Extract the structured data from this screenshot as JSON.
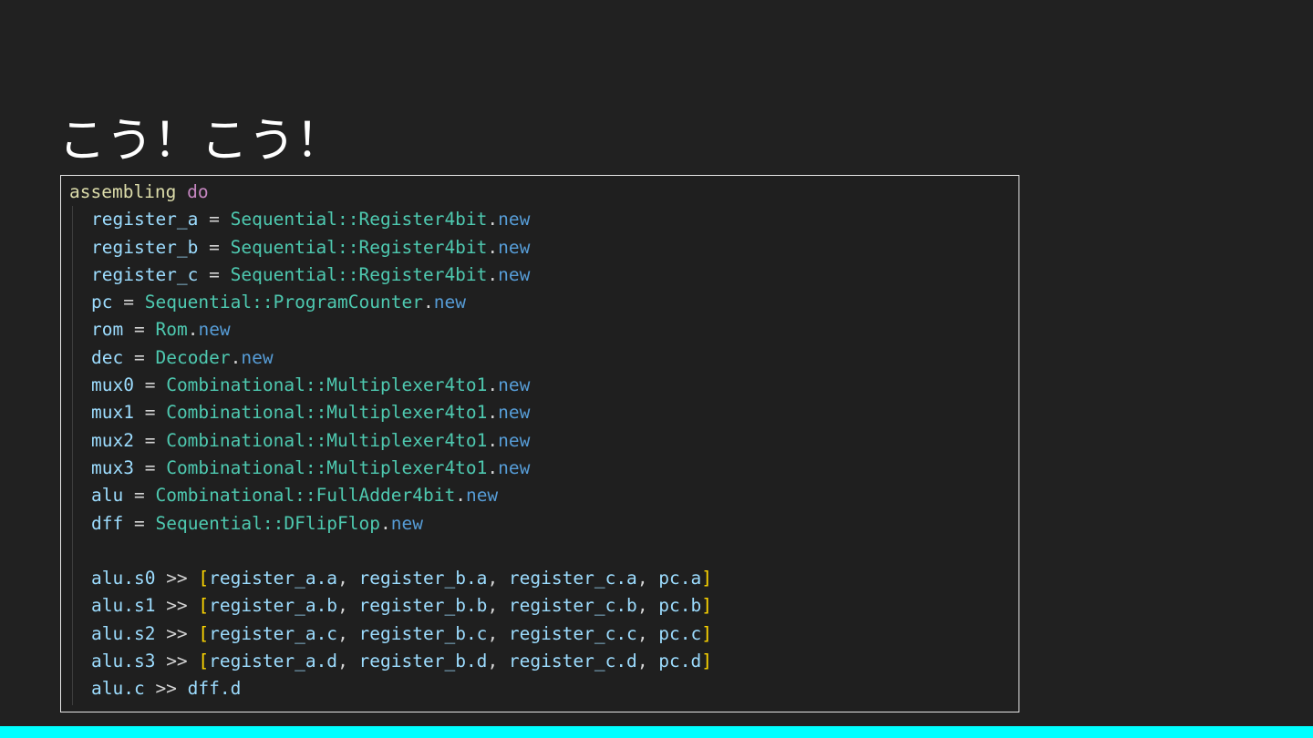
{
  "slide": {
    "title": "こう！こう！"
  },
  "code": {
    "lines": [
      [
        {
          "t": "assembling",
          "c": "fn"
        },
        {
          "t": " ",
          "c": "op"
        },
        {
          "t": "do",
          "c": "kw"
        }
      ],
      [
        {
          "t": "register_a",
          "c": "var"
        },
        {
          "t": " = ",
          "c": "op"
        },
        {
          "t": "Sequential::Register4bit",
          "c": "cls"
        },
        {
          "t": ".",
          "c": "op"
        },
        {
          "t": "new",
          "c": "new"
        }
      ],
      [
        {
          "t": "register_b",
          "c": "var"
        },
        {
          "t": " = ",
          "c": "op"
        },
        {
          "t": "Sequential::Register4bit",
          "c": "cls"
        },
        {
          "t": ".",
          "c": "op"
        },
        {
          "t": "new",
          "c": "new"
        }
      ],
      [
        {
          "t": "register_c",
          "c": "var"
        },
        {
          "t": " = ",
          "c": "op"
        },
        {
          "t": "Sequential::Register4bit",
          "c": "cls"
        },
        {
          "t": ".",
          "c": "op"
        },
        {
          "t": "new",
          "c": "new"
        }
      ],
      [
        {
          "t": "pc",
          "c": "var"
        },
        {
          "t": " = ",
          "c": "op"
        },
        {
          "t": "Sequential::ProgramCounter",
          "c": "cls"
        },
        {
          "t": ".",
          "c": "op"
        },
        {
          "t": "new",
          "c": "new"
        }
      ],
      [
        {
          "t": "rom",
          "c": "var"
        },
        {
          "t": " = ",
          "c": "op"
        },
        {
          "t": "Rom",
          "c": "cls"
        },
        {
          "t": ".",
          "c": "op"
        },
        {
          "t": "new",
          "c": "new"
        }
      ],
      [
        {
          "t": "dec",
          "c": "var"
        },
        {
          "t": " = ",
          "c": "op"
        },
        {
          "t": "Decoder",
          "c": "cls"
        },
        {
          "t": ".",
          "c": "op"
        },
        {
          "t": "new",
          "c": "new"
        }
      ],
      [
        {
          "t": "mux0",
          "c": "var"
        },
        {
          "t": " = ",
          "c": "op"
        },
        {
          "t": "Combinational::Multiplexer4to1",
          "c": "cls"
        },
        {
          "t": ".",
          "c": "op"
        },
        {
          "t": "new",
          "c": "new"
        }
      ],
      [
        {
          "t": "mux1",
          "c": "var"
        },
        {
          "t": " = ",
          "c": "op"
        },
        {
          "t": "Combinational::Multiplexer4to1",
          "c": "cls"
        },
        {
          "t": ".",
          "c": "op"
        },
        {
          "t": "new",
          "c": "new"
        }
      ],
      [
        {
          "t": "mux2",
          "c": "var"
        },
        {
          "t": " = ",
          "c": "op"
        },
        {
          "t": "Combinational::Multiplexer4to1",
          "c": "cls"
        },
        {
          "t": ".",
          "c": "op"
        },
        {
          "t": "new",
          "c": "new"
        }
      ],
      [
        {
          "t": "mux3",
          "c": "var"
        },
        {
          "t": " = ",
          "c": "op"
        },
        {
          "t": "Combinational::Multiplexer4to1",
          "c": "cls"
        },
        {
          "t": ".",
          "c": "op"
        },
        {
          "t": "new",
          "c": "new"
        }
      ],
      [
        {
          "t": "alu",
          "c": "var"
        },
        {
          "t": " = ",
          "c": "op"
        },
        {
          "t": "Combinational::FullAdder4bit",
          "c": "cls"
        },
        {
          "t": ".",
          "c": "op"
        },
        {
          "t": "new",
          "c": "new"
        }
      ],
      [
        {
          "t": "dff",
          "c": "var"
        },
        {
          "t": " = ",
          "c": "op"
        },
        {
          "t": "Sequential::DFlipFlop",
          "c": "cls"
        },
        {
          "t": ".",
          "c": "op"
        },
        {
          "t": "new",
          "c": "new"
        }
      ],
      [],
      [
        {
          "t": "alu.s0",
          "c": "var"
        },
        {
          "t": " >> ",
          "c": "op"
        },
        {
          "t": "[",
          "c": "brk"
        },
        {
          "t": "register_a.a",
          "c": "var"
        },
        {
          "t": ", ",
          "c": "op"
        },
        {
          "t": "register_b.a",
          "c": "var"
        },
        {
          "t": ", ",
          "c": "op"
        },
        {
          "t": "register_c.a",
          "c": "var"
        },
        {
          "t": ", ",
          "c": "op"
        },
        {
          "t": "pc.a",
          "c": "var"
        },
        {
          "t": "]",
          "c": "brk"
        }
      ],
      [
        {
          "t": "alu.s1",
          "c": "var"
        },
        {
          "t": " >> ",
          "c": "op"
        },
        {
          "t": "[",
          "c": "brk"
        },
        {
          "t": "register_a.b",
          "c": "var"
        },
        {
          "t": ", ",
          "c": "op"
        },
        {
          "t": "register_b.b",
          "c": "var"
        },
        {
          "t": ", ",
          "c": "op"
        },
        {
          "t": "register_c.b",
          "c": "var"
        },
        {
          "t": ", ",
          "c": "op"
        },
        {
          "t": "pc.b",
          "c": "var"
        },
        {
          "t": "]",
          "c": "brk"
        }
      ],
      [
        {
          "t": "alu.s2",
          "c": "var"
        },
        {
          "t": " >> ",
          "c": "op"
        },
        {
          "t": "[",
          "c": "brk"
        },
        {
          "t": "register_a.c",
          "c": "var"
        },
        {
          "t": ", ",
          "c": "op"
        },
        {
          "t": "register_b.c",
          "c": "var"
        },
        {
          "t": ", ",
          "c": "op"
        },
        {
          "t": "register_c.c",
          "c": "var"
        },
        {
          "t": ", ",
          "c": "op"
        },
        {
          "t": "pc.c",
          "c": "var"
        },
        {
          "t": "]",
          "c": "brk"
        }
      ],
      [
        {
          "t": "alu.s3",
          "c": "var"
        },
        {
          "t": " >> ",
          "c": "op"
        },
        {
          "t": "[",
          "c": "brk"
        },
        {
          "t": "register_a.d",
          "c": "var"
        },
        {
          "t": ", ",
          "c": "op"
        },
        {
          "t": "register_b.d",
          "c": "var"
        },
        {
          "t": ", ",
          "c": "op"
        },
        {
          "t": "register_c.d",
          "c": "var"
        },
        {
          "t": ", ",
          "c": "op"
        },
        {
          "t": "pc.d",
          "c": "var"
        },
        {
          "t": "]",
          "c": "brk"
        }
      ],
      [
        {
          "t": "alu.c",
          "c": "var"
        },
        {
          "t": " >> ",
          "c": "op"
        },
        {
          "t": "dff.d",
          "c": "var"
        }
      ]
    ]
  },
  "colors": {
    "background": "#212121",
    "frame_border": "#e6e6e6",
    "accent_bar": "#00ffff"
  }
}
